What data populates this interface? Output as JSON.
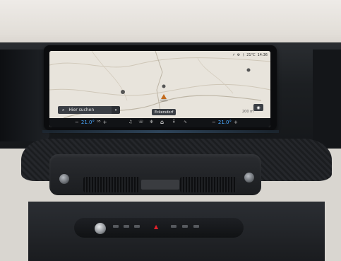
{
  "map": {
    "search_placeholder": "Hier suchen",
    "position_label": "Eckersdorf",
    "scale_label": "200 m",
    "status_bar": {
      "temperature": "21°C",
      "time": "14:36"
    }
  },
  "climate": {
    "driver_temp": "21.0°",
    "driver_unit": "⁰⁵",
    "passenger_temp": "21.0°"
  },
  "icons": {
    "search": "search-icon",
    "home": "home-icon",
    "media": "music-icon",
    "fan": "fan-icon",
    "grid": "apps-icon",
    "phone": "phone-icon",
    "map_view": "map-view-icon",
    "hazard": "hazard-icon"
  },
  "colors": {
    "temp_accent": "#4aa8ff",
    "hazard": "#e0202a",
    "map_land": "#e8e4dc"
  }
}
